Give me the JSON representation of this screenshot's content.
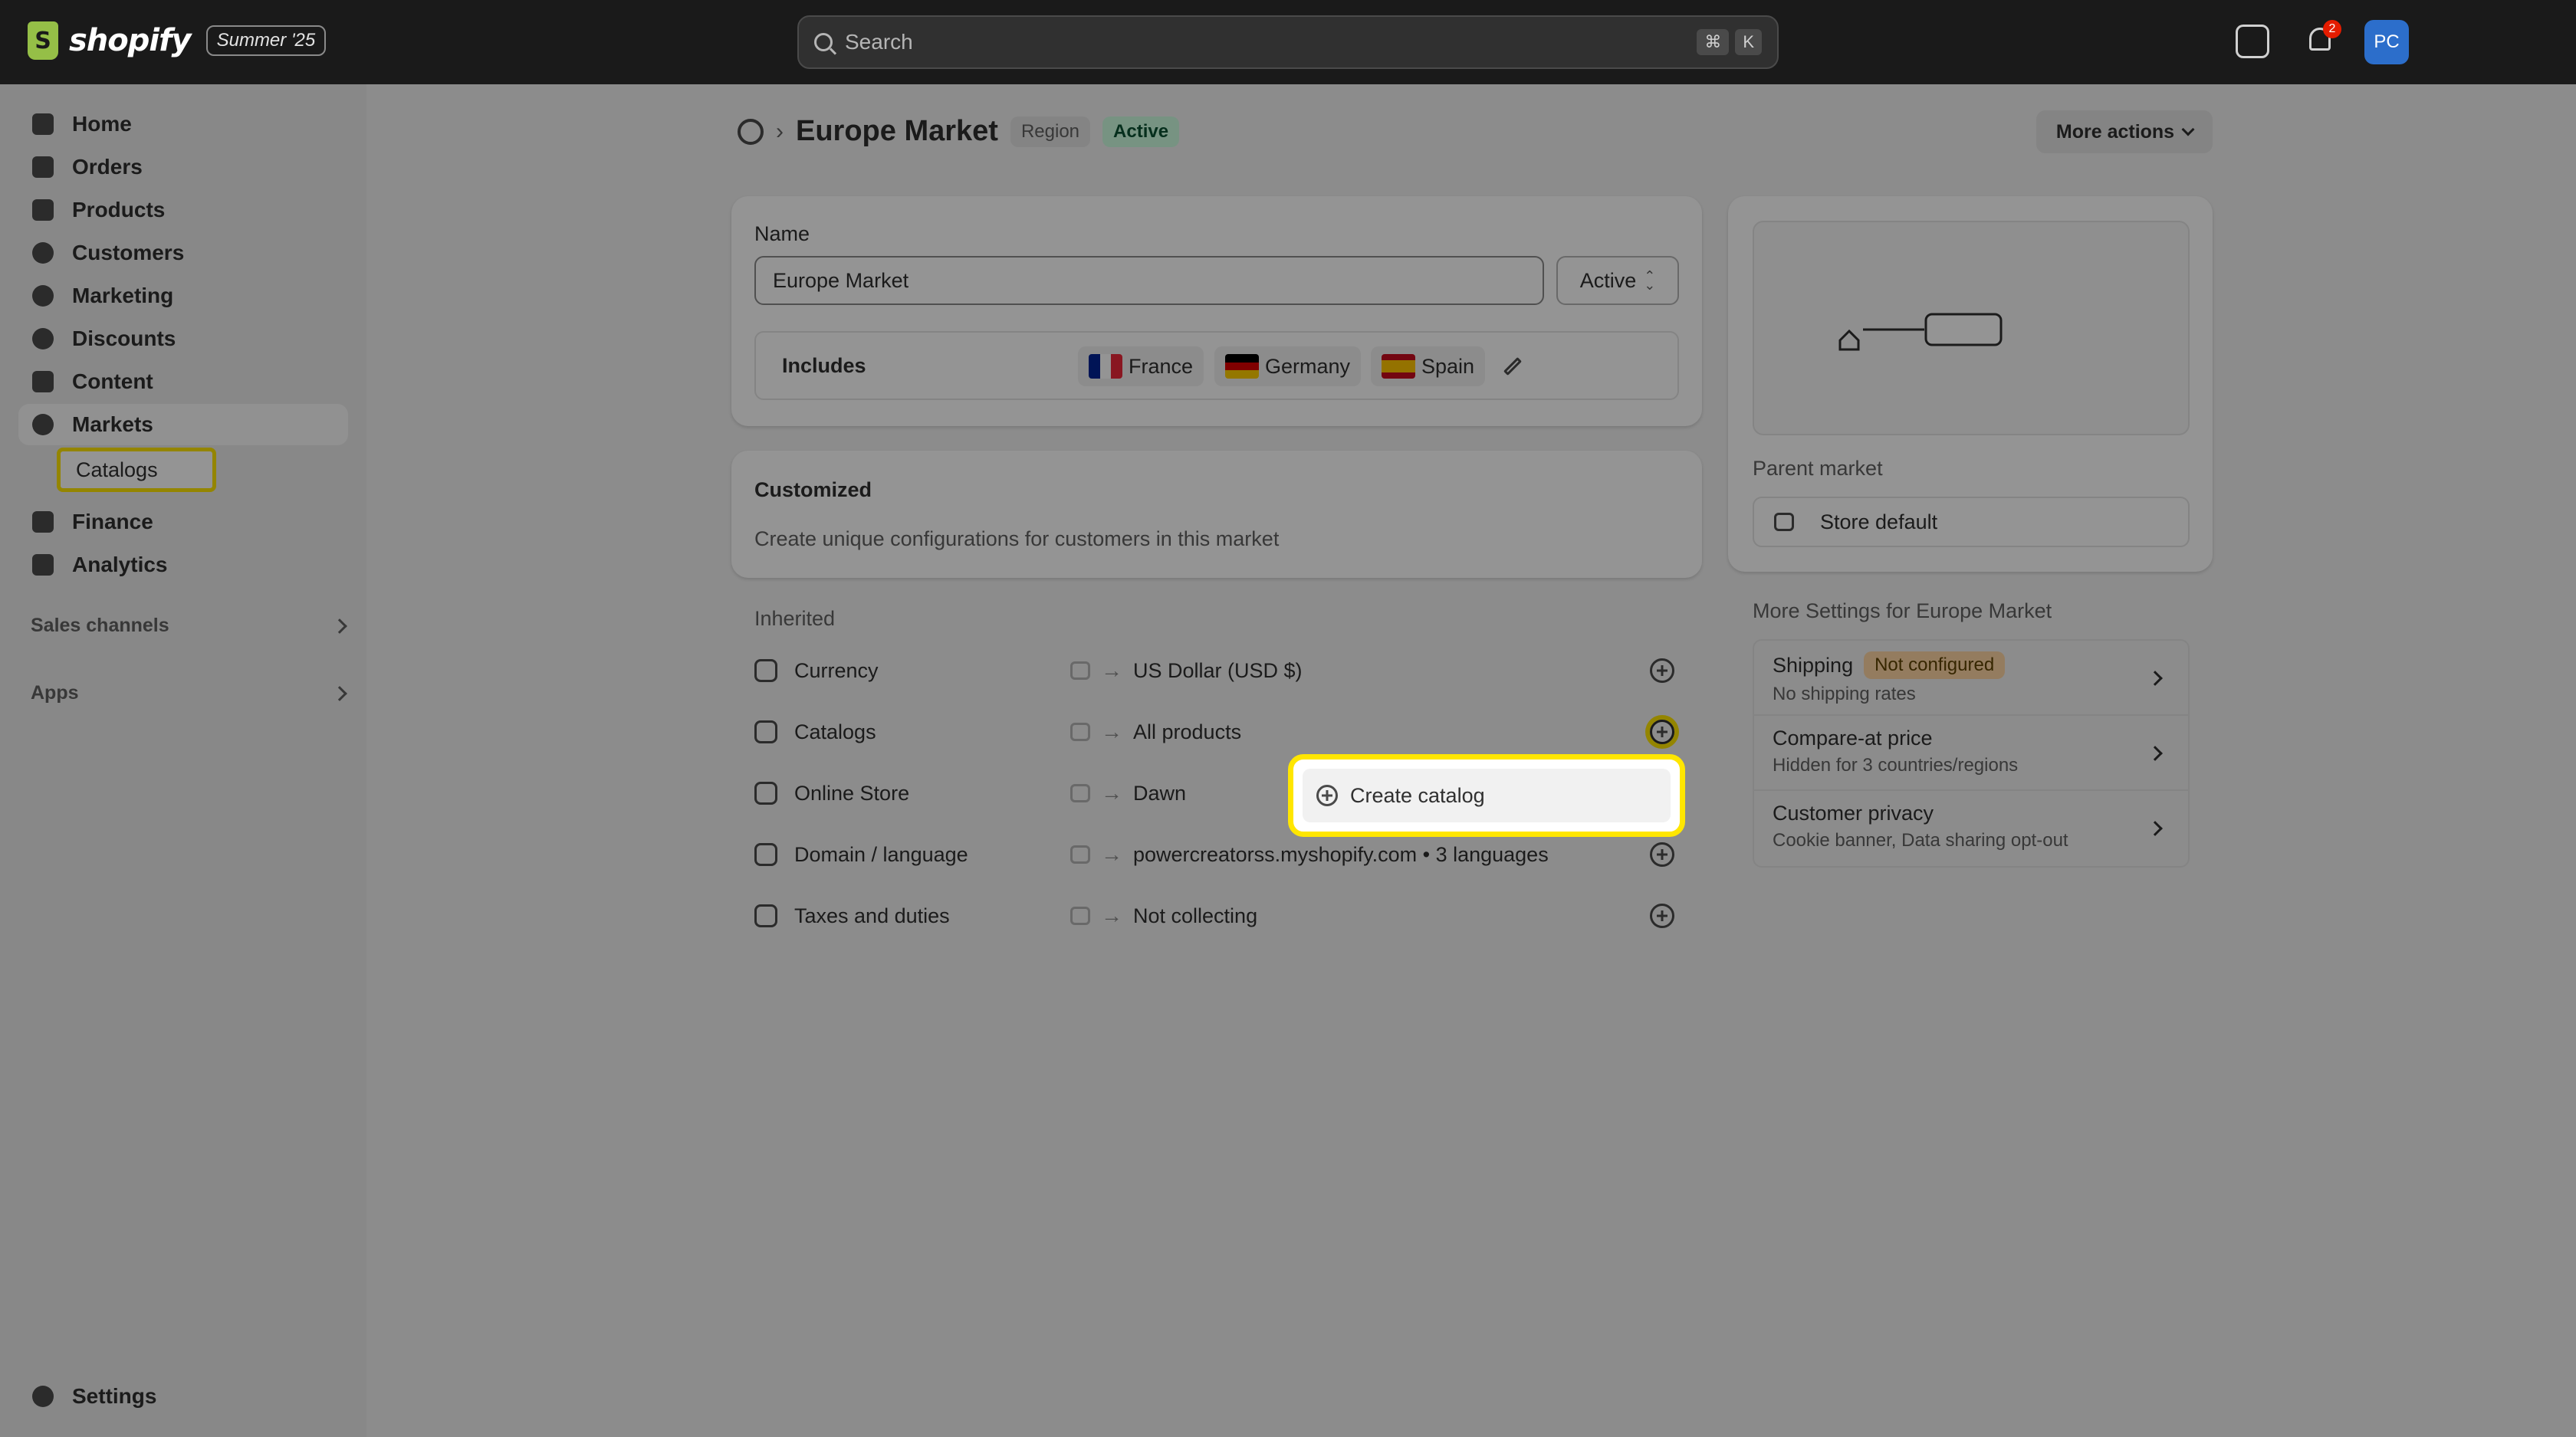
{
  "topbar": {
    "brand": "shopify",
    "edition": "Summer '25",
    "search_placeholder": "Search",
    "shortcut": [
      "⌘",
      "K"
    ],
    "notification_count": "2",
    "avatar_initials": "PC"
  },
  "sidebar": {
    "items": [
      {
        "label": "Home",
        "icon": "home-icon"
      },
      {
        "label": "Orders",
        "icon": "orders-icon"
      },
      {
        "label": "Products",
        "icon": "tag-icon"
      },
      {
        "label": "Customers",
        "icon": "person-icon"
      },
      {
        "label": "Marketing",
        "icon": "target-icon"
      },
      {
        "label": "Discounts",
        "icon": "discount-icon"
      },
      {
        "label": "Content",
        "icon": "image-icon"
      },
      {
        "label": "Markets",
        "icon": "globe-icon"
      },
      {
        "label": "Finance",
        "icon": "bank-icon"
      },
      {
        "label": "Analytics",
        "icon": "bar-chart-icon"
      }
    ],
    "sub_item": "Catalogs",
    "sales_channels": "Sales channels",
    "apps": "Apps",
    "settings": "Settings"
  },
  "page": {
    "title": "Europe Market",
    "badge_region": "Region",
    "badge_status": "Active",
    "more_actions": "More actions"
  },
  "name_card": {
    "name_label": "Name",
    "name_value": "Europe Market",
    "status_select": "Active",
    "includes_label": "Includes",
    "countries": [
      "France",
      "Germany",
      "Spain"
    ]
  },
  "customized": {
    "title": "Customized",
    "description": "Create unique configurations for customers in this market"
  },
  "inherited": {
    "title": "Inherited",
    "rows": [
      {
        "name": "Currency",
        "value": "US Dollar (USD $)"
      },
      {
        "name": "Catalogs",
        "value": "All products"
      },
      {
        "name": "Online Store",
        "value": "Dawn"
      },
      {
        "name": "Domain / language",
        "value": "powercreatorss.myshopify.com • 3 languages"
      },
      {
        "name": "Taxes and duties",
        "value": "Not collecting"
      }
    ]
  },
  "popover": {
    "create_catalog": "Create catalog"
  },
  "side": {
    "parent_market_label": "Parent market",
    "parent_market_value": "Store default",
    "more_settings_title": "More Settings for Europe Market",
    "settings": [
      {
        "title": "Shipping",
        "badge": "Not configured",
        "sub": "No shipping rates"
      },
      {
        "title": "Compare-at price",
        "sub": "Hidden for 3 countries/regions"
      },
      {
        "title": "Customer privacy",
        "sub": "Cookie banner, Data sharing opt-out"
      }
    ]
  }
}
